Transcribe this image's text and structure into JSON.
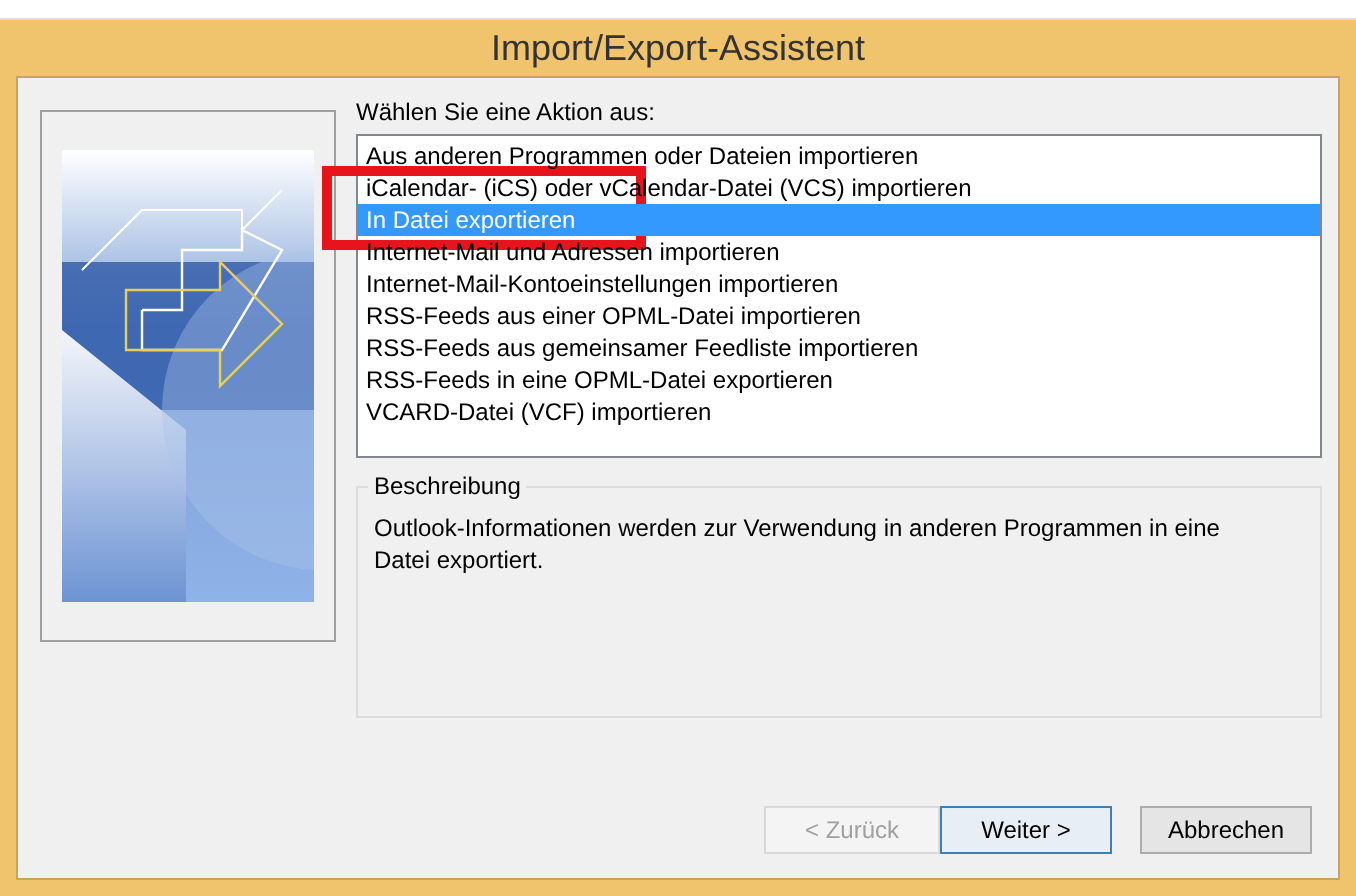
{
  "window": {
    "title": "Import/Export-Assistent"
  },
  "prompt": "Wählen Sie eine Aktion aus:",
  "actions": [
    {
      "label": "Aus anderen Programmen oder Dateien importieren",
      "selected": false
    },
    {
      "label": "iCalendar- (iCS) oder vCalendar-Datei (VCS) importieren",
      "selected": false
    },
    {
      "label": "In Datei exportieren",
      "selected": true
    },
    {
      "label": "Internet-Mail und Adressen importieren",
      "selected": false
    },
    {
      "label": "Internet-Mail-Kontoeinstellungen importieren",
      "selected": false
    },
    {
      "label": "RSS-Feeds aus einer OPML-Datei importieren",
      "selected": false
    },
    {
      "label": "RSS-Feeds aus gemeinsamer Feedliste importieren",
      "selected": false
    },
    {
      "label": "RSS-Feeds in eine OPML-Datei exportieren",
      "selected": false
    },
    {
      "label": "VCARD-Datei (VCF) importieren",
      "selected": false
    }
  ],
  "description": {
    "title": "Beschreibung",
    "text": "Outlook-Informationen werden zur Verwendung in anderen Programmen in eine Datei exportiert."
  },
  "buttons": [
    {
      "label": "< Zurück",
      "disabled": true,
      "default": false
    },
    {
      "label": "Weiter >",
      "disabled": false,
      "default": true
    },
    {
      "label": "Abbrechen",
      "disabled": false,
      "default": false
    }
  ]
}
